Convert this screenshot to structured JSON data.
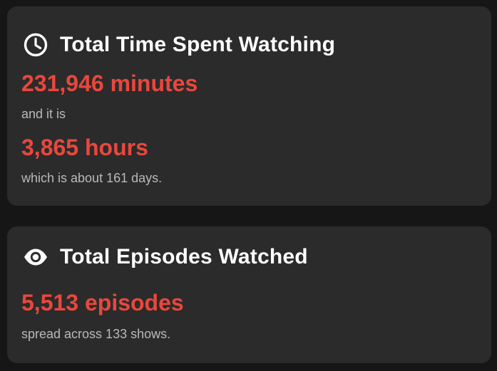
{
  "time_card": {
    "icon": "clock-icon",
    "title": "Total Time Spent Watching",
    "minutes": "231,946 minutes",
    "connector": "and it is",
    "hours": "3,865 hours",
    "days_text": "which is about 161 days."
  },
  "episodes_card": {
    "icon": "eye-icon",
    "title": "Total Episodes Watched",
    "episodes": "5,513 episodes",
    "shows_text": "spread across 133 shows."
  },
  "colors": {
    "background": "#161616",
    "card": "#2b2b2b",
    "accent": "#e9473d",
    "title": "#ffffff",
    "muted": "#b9b9b9"
  }
}
